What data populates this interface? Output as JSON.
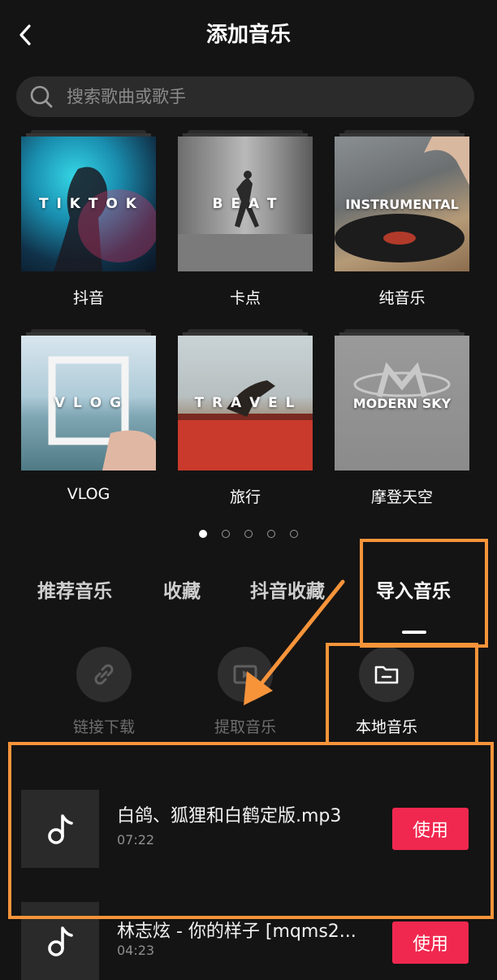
{
  "header": {
    "title": "添加音乐"
  },
  "search": {
    "placeholder": "搜索歌曲或歌手"
  },
  "categories": [
    {
      "cover_text": "T I K T O K",
      "name": "抖音"
    },
    {
      "cover_text": "B E A T",
      "name": "卡点"
    },
    {
      "cover_text": "INSTRUMENTAL",
      "name": "纯音乐"
    },
    {
      "cover_text": "V L O G",
      "name": "VLOG"
    },
    {
      "cover_text": "T R A V E L",
      "name": "旅行"
    },
    {
      "cover_text": "MODERN SKY",
      "name": "摩登天空"
    }
  ],
  "pagination": {
    "total": 5,
    "active": 1
  },
  "tabs": [
    {
      "label": "推荐音乐"
    },
    {
      "label": "收藏"
    },
    {
      "label": "抖音收藏"
    },
    {
      "label": "导入音乐",
      "active": true
    }
  ],
  "actions": [
    {
      "label": "链接下载",
      "icon": "link-icon"
    },
    {
      "label": "提取音乐",
      "icon": "video-extract-icon"
    },
    {
      "label": "本地音乐",
      "icon": "folder-icon"
    }
  ],
  "songs": [
    {
      "name": "白鸽、狐狸和白鹤定版.mp3",
      "duration": "07:22",
      "button": "使用"
    },
    {
      "name": "林志炫 - 你的样子 [mqms2...",
      "duration": "04:23",
      "button": "使用"
    }
  ],
  "colors": {
    "background": "#141414",
    "accent": "#f0284f",
    "annotation": "#f7943a"
  }
}
